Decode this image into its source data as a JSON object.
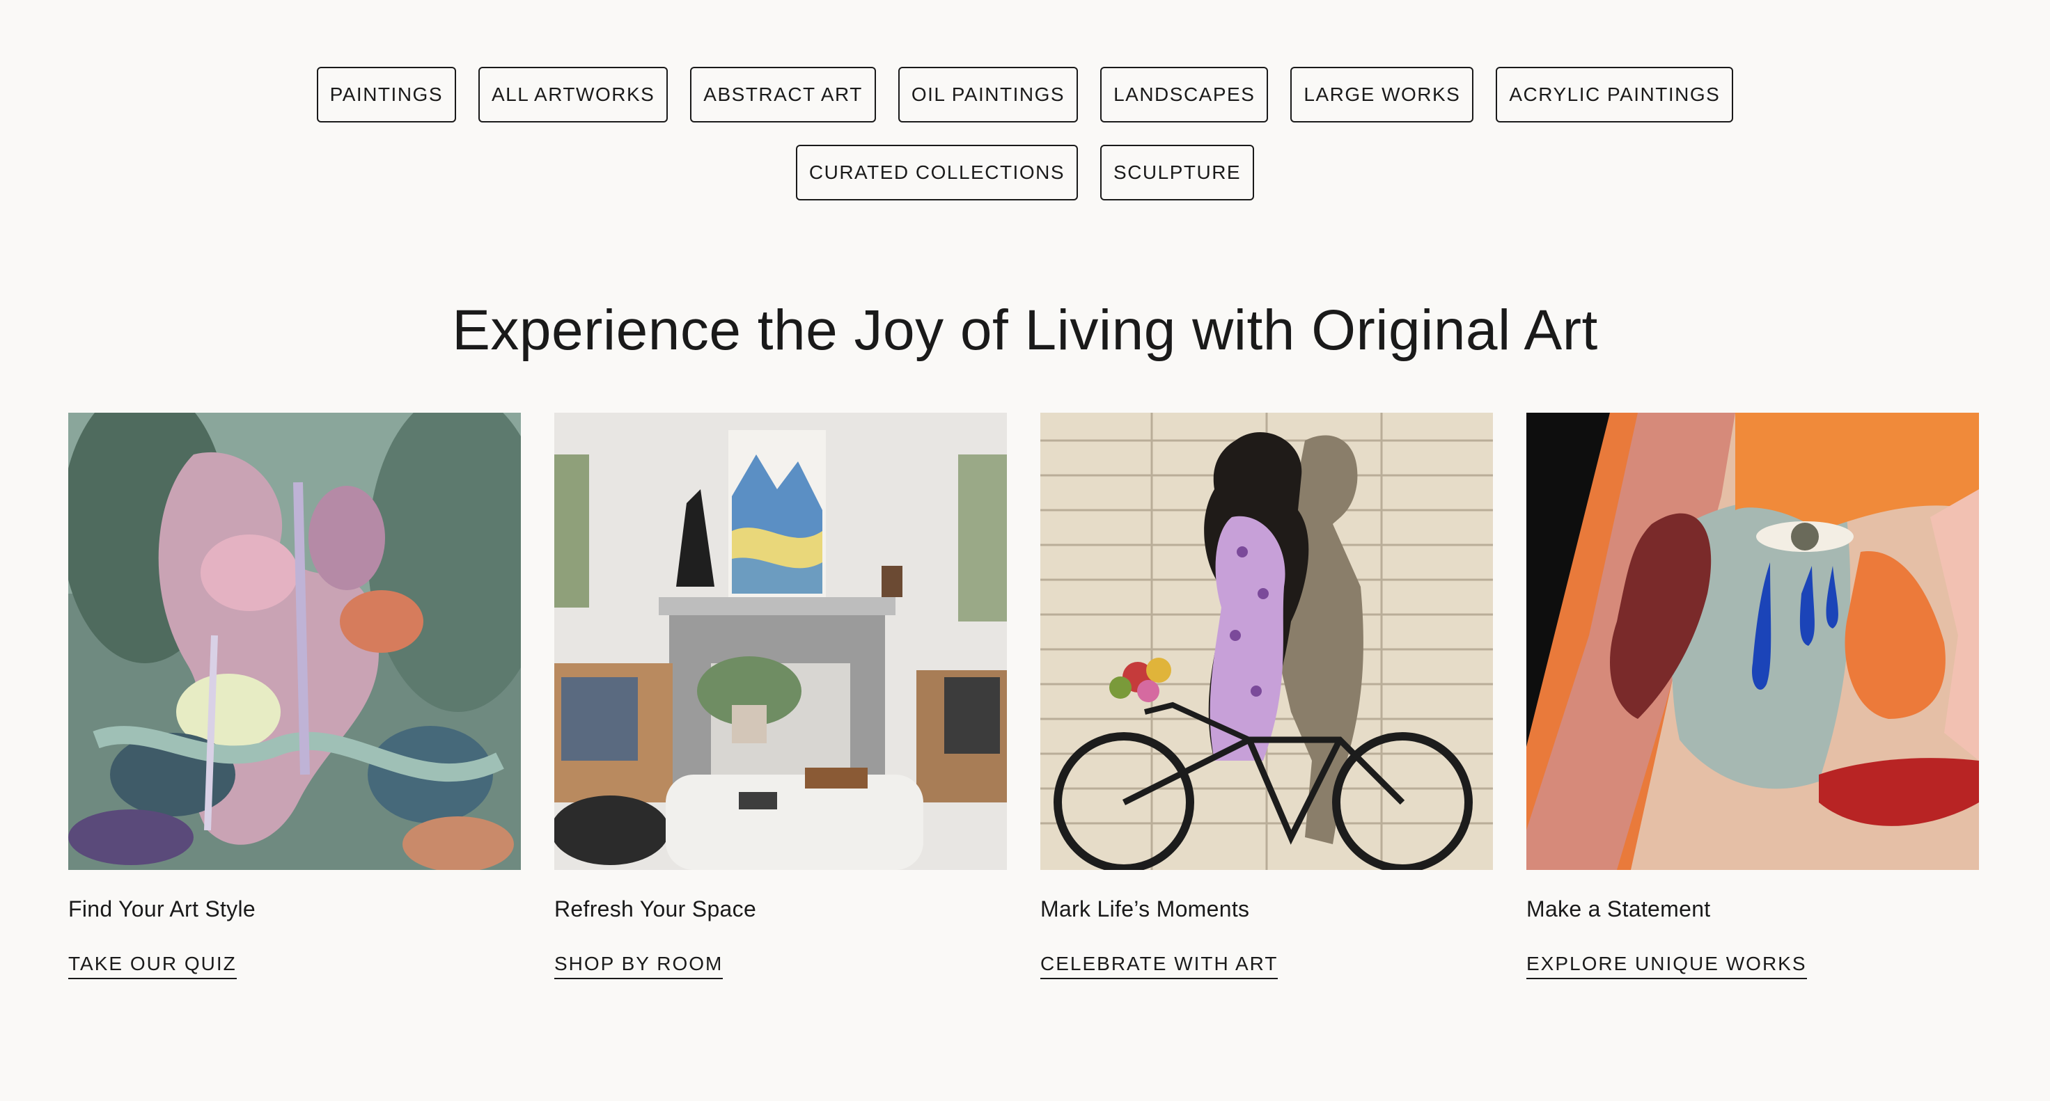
{
  "categories": [
    "PAINTINGS",
    "ALL ARTWORKS",
    "ABSTRACT ART",
    "OIL PAINTINGS",
    "LANDSCAPES",
    "LARGE WORKS",
    "ACRYLIC PAINTINGS",
    "CURATED COLLECTIONS",
    "SCULPTURE"
  ],
  "headline": "Experience the Joy of Living with Original Art",
  "cards": [
    {
      "title": "Find Your Art Style",
      "link": "TAKE OUR QUIZ"
    },
    {
      "title": "Refresh Your Space",
      "link": "SHOP BY ROOM"
    },
    {
      "title": "Mark Life’s Moments",
      "link": "CELEBRATE WITH ART"
    },
    {
      "title": "Make a Statement",
      "link": "EXPLORE UNIQUE WORKS"
    }
  ],
  "colors": {
    "background": "#faf9f7",
    "text": "#1a1a1a"
  }
}
